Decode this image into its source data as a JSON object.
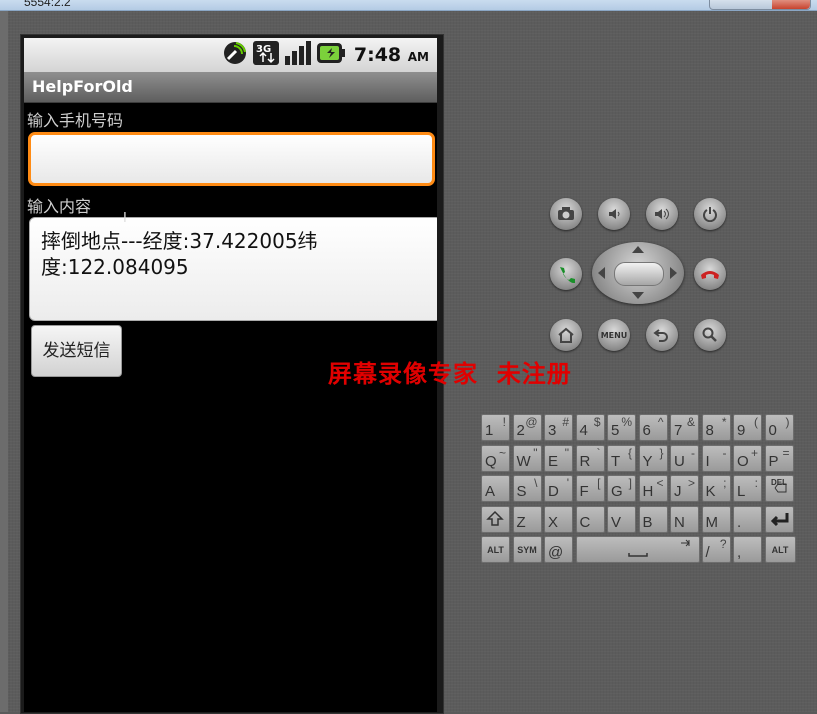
{
  "window": {
    "title": "5554:2.2"
  },
  "statusbar": {
    "time": "7:48",
    "ampm": "AM",
    "network": "3G"
  },
  "app": {
    "title": "HelpForOld",
    "phone_label": "输入手机号码",
    "phone_value": "",
    "content_label": "输入内容",
    "content_value": "摔倒地点---经度:37.422005纬度:122.084095",
    "send_button": "发送短信"
  },
  "watermark": "屏幕录像专家  未注册",
  "controls": {
    "camera": "camera-icon",
    "vol_down": "volume-down-icon",
    "vol_up": "volume-up-icon",
    "power": "power-icon",
    "call": "call-icon",
    "end_call": "end-call-icon",
    "home": "home-icon",
    "menu": "MENU",
    "back": "back-icon",
    "search": "search-icon"
  },
  "keyboard": {
    "rows": [
      [
        [
          "1",
          "!"
        ],
        [
          "2",
          "@"
        ],
        [
          "3",
          "#"
        ],
        [
          "4",
          "$"
        ],
        [
          "5",
          "%"
        ],
        [
          "6",
          "^"
        ],
        [
          "7",
          "&"
        ],
        [
          "8",
          "*"
        ],
        [
          "9",
          "("
        ],
        [
          "0",
          ")"
        ]
      ],
      [
        [
          "Q",
          "~"
        ],
        [
          "W",
          "\""
        ],
        [
          "E",
          "\""
        ],
        [
          "R",
          "`"
        ],
        [
          "T",
          "{"
        ],
        [
          "Y",
          "}"
        ],
        [
          "U",
          "-"
        ],
        [
          "I",
          "-"
        ],
        [
          "O",
          "+"
        ],
        [
          "P",
          "="
        ]
      ],
      [
        [
          "A",
          ""
        ],
        [
          "S",
          "\\"
        ],
        [
          "D",
          "'"
        ],
        [
          "F",
          "["
        ],
        [
          "G",
          "]"
        ],
        [
          "H",
          "<"
        ],
        [
          "J",
          ">"
        ],
        [
          "K",
          ";"
        ],
        [
          "L",
          ":"
        ],
        [
          "DEL",
          ""
        ]
      ],
      [
        [
          "SHIFT",
          ""
        ],
        [
          "Z",
          ""
        ],
        [
          "X",
          ""
        ],
        [
          "C",
          ""
        ],
        [
          "V",
          ""
        ],
        [
          "B",
          ""
        ],
        [
          "N",
          ""
        ],
        [
          "M",
          ""
        ],
        [
          ".",
          ""
        ],
        [
          "ENTER",
          ""
        ]
      ]
    ],
    "bottom": {
      "alt_left": "ALT",
      "sym": "SYM",
      "at": "@",
      "slash": "/",
      "question": "?",
      "comma": ",",
      "alt_right": "ALT"
    }
  }
}
